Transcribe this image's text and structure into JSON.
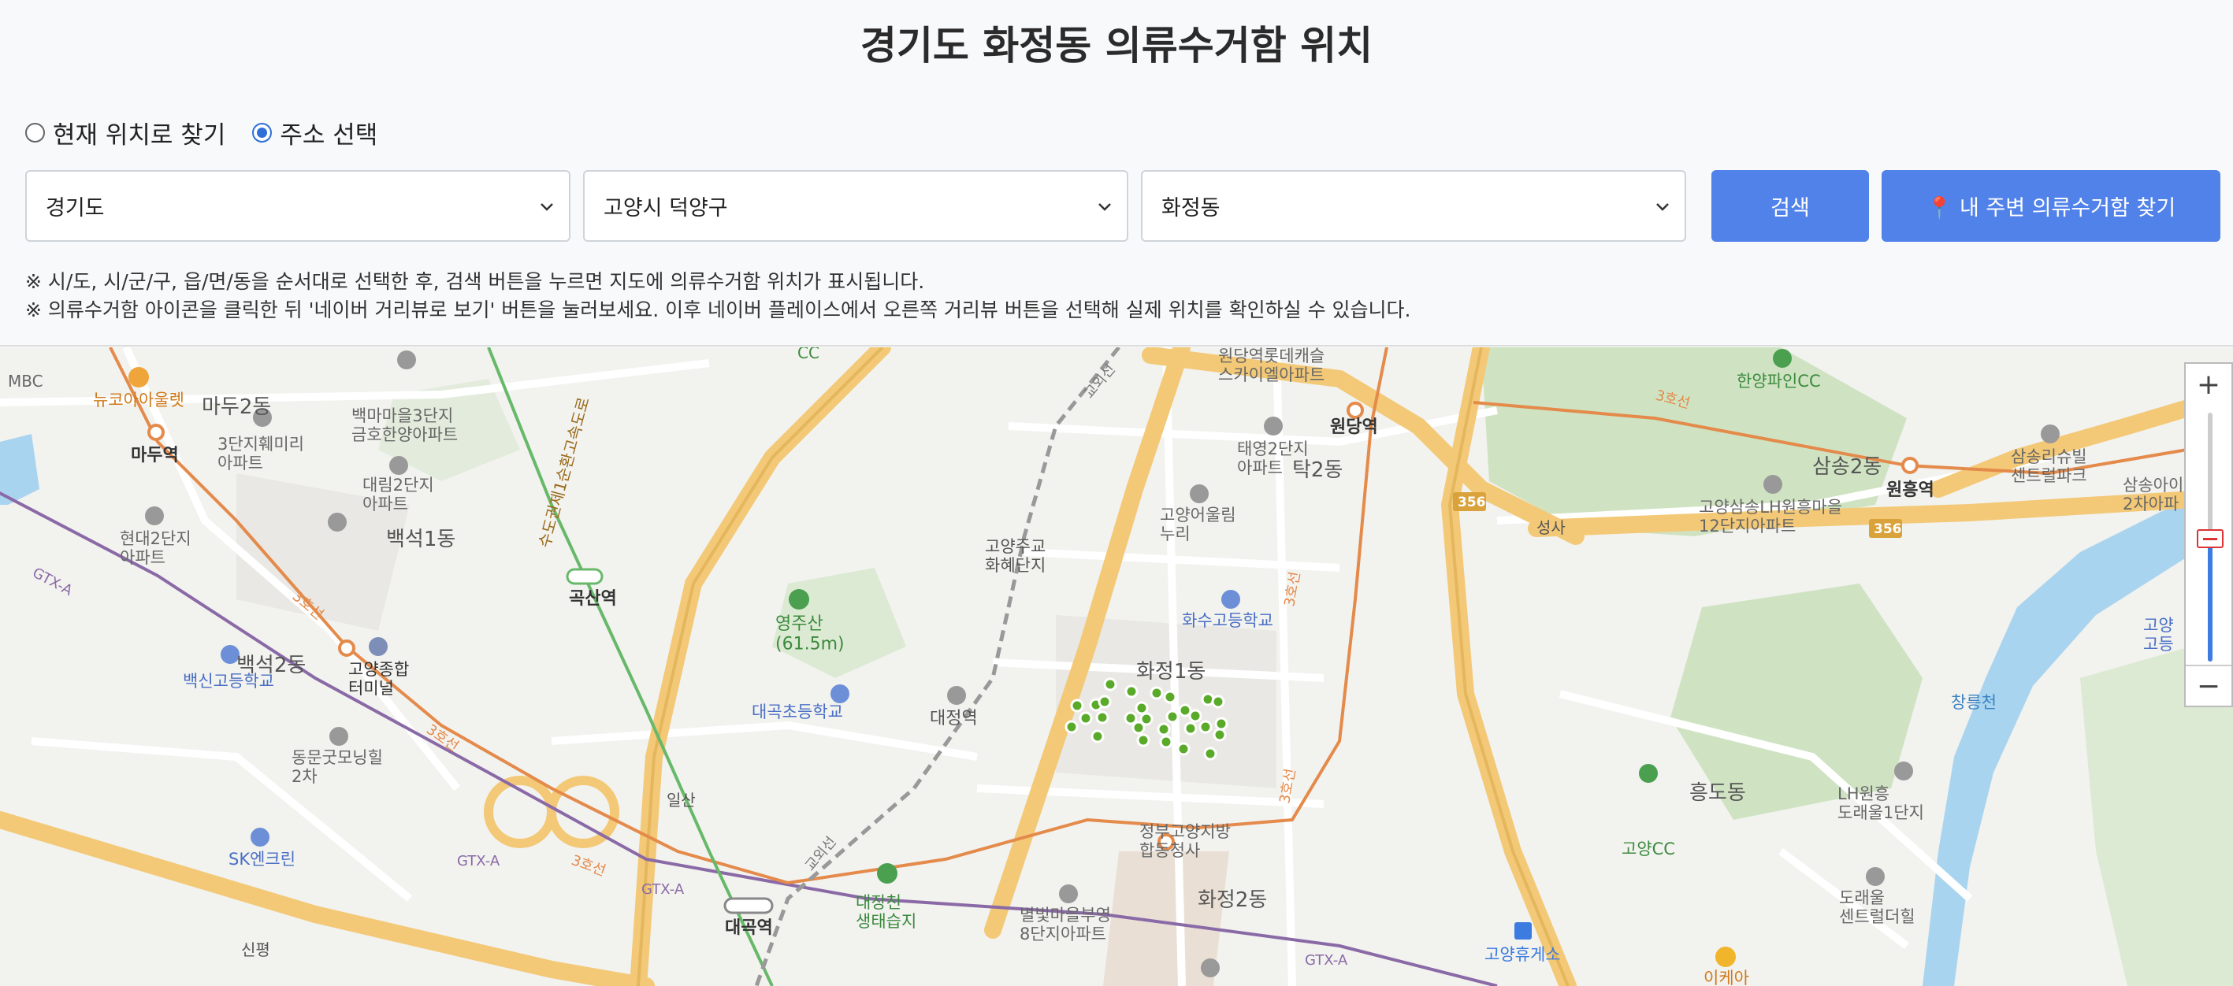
{
  "page": {
    "title": "경기도 화정동 의류수거함 위치"
  },
  "mode": {
    "current_location_label": "현재 위치로 찾기",
    "address_select_label": "주소 선택",
    "selected": "address"
  },
  "filters": {
    "province": "경기도",
    "city": "고양시 덕양구",
    "dong": "화정동"
  },
  "buttons": {
    "search": "검색",
    "nearby": "📍 내 주변 의류수거함 찾기"
  },
  "notes": [
    "※ 시/도, 시/군/구, 읍/면/동을 순서대로 선택한 후, 검색 버튼을 누르면 지도에 의류수거함 위치가 표시됩니다.",
    "※ 의류수거함 아이콘을 클릭한 뒤 '네이버 거리뷰로 보기' 버튼을 눌러보세요. 이후 네이버 플레이스에서 오른쪽 거리뷰 버튼을 선택해 실제 위치를 확인하실 수 있습니다."
  ],
  "map": {
    "zoom_in": "+",
    "zoom_out": "−",
    "labels": {
      "mbc": "MBC",
      "newcore": "뉴코아아울렛",
      "madu2": "마두2동",
      "madu_st": "마두역",
      "apt_3danji": "3단지훼미리\n아파트",
      "baekma": "백마마을3단지\n금호한양아파트",
      "daerim": "대림2단지\n아파트",
      "hyundai": "현대2단지\n아파트",
      "baekseok1": "백석1동",
      "baekseok2": "백석2동",
      "baekshin": "백신고등학교",
      "terminal": "고양종합\n터미널",
      "dongmun": "동문굿모닝힐\n2차",
      "sk": "SK엔크린",
      "ilsan": "일산",
      "gokdsan": "곡산역",
      "yeongjusan": "영주산\n(61.5m)",
      "daegok_elem": "대곡초등학교",
      "daejeong": "대정역",
      "daegok": "대곡역",
      "daejang": "대장천\n생태습지",
      "goyangjugyo": "고양주교\n화혜단지",
      "hwajeong1": "화정1동",
      "hwajeong2": "화정2동",
      "hwasu_high": "화수고등학교",
      "goyang_oullim": "고양어울림\n누리",
      "taeyoung": "태영2단지\n아파트",
      "tak2": "탁2동",
      "wondang_lotte": "원당역롯데캐슬\n스카이엘아파트",
      "wondang": "원당역",
      "jeongbu": "정부고양지방\n합동청사",
      "byeolbit": "별빛마을부영\n8단지아파트",
      "hanyang_pine": "한양파인CC",
      "samsong2": "삼송2동",
      "samsong_lh": "고양삼송LH원흥마을\n12단지아파트",
      "wonheung": "원흥역",
      "samsong_lishu": "삼송리슈빌\n센트럴파크",
      "samsong_apt": "삼송아이\n2차아파",
      "seongsa": "성사",
      "heungdo": "흥도동",
      "goyang_cc": "고양CC",
      "lh_wonheung": "LH원흥\n도래울1단지",
      "doraeul": "도래울\n센트럴더힐",
      "goyang_rest": "고양휴게소",
      "ikea": "이케아",
      "changneung": "창릉천",
      "goyang_high": "고양\n고등",
      "sinpyeong": "신평",
      "gtx": "GTX-A",
      "line3": "3호선",
      "gyooe": "교외선",
      "road356": "356",
      "expressway": "수도권제1순환고속도로",
      "cc_top": "CC"
    }
  },
  "colors": {
    "accent": "#5182ea",
    "marker": "#5aaa2a",
    "line3": "#e48a4a",
    "gtx": "#8a6aa6",
    "park": "#cfe3c2",
    "water": "#a9d4ef",
    "road_major": "#f3c977"
  }
}
